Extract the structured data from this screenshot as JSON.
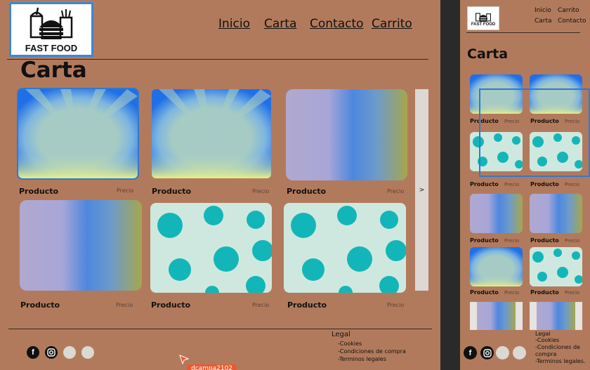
{
  "brand": {
    "name": "FAST FOOD"
  },
  "nav": {
    "inicio": "Inicio",
    "carta": "Carta",
    "contacto": "Contacto",
    "carrito": "Carrito"
  },
  "page_title": "Carta",
  "product": {
    "name": "Producto",
    "price": "Precio"
  },
  "carousel": {
    "next": ">"
  },
  "footer": {
    "legal_title": "Legal",
    "items": [
      "-Cookies",
      "-Condiciones de compra",
      "-Terminos  legales"
    ],
    "mobile_items": [
      "-Cookies",
      "-Condiciones de compra",
      "-Terminos  legales."
    ]
  },
  "cursor_tag": "dcampa2102",
  "icons": [
    "facebook-icon",
    "instagram-icon",
    "circle-icon",
    "circle-icon"
  ],
  "colors": {
    "background": "#b27a5c",
    "selection": "#2f79d1",
    "tag": "#e85a2f"
  }
}
